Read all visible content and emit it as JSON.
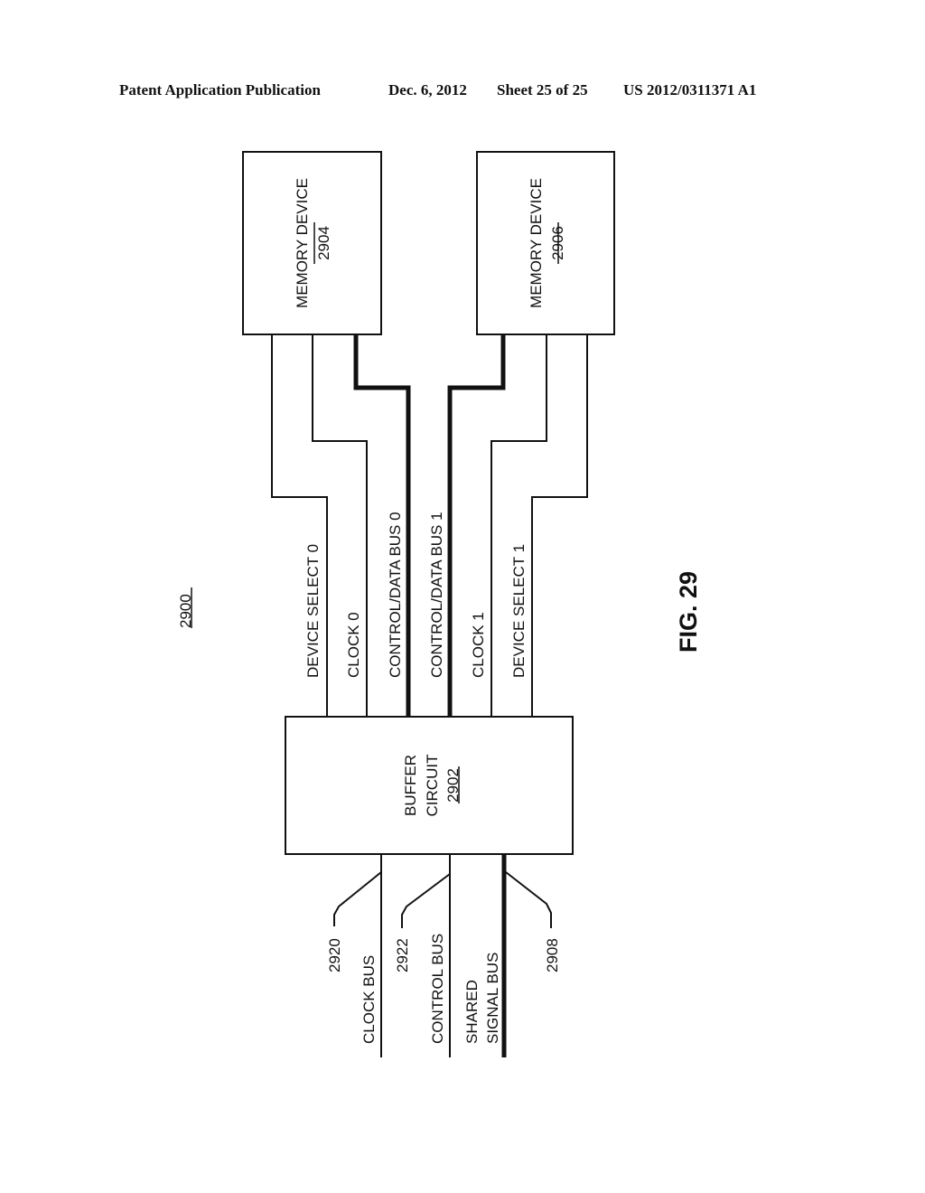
{
  "header": {
    "publication": "Patent Application Publication",
    "date": "Dec. 6, 2012",
    "sheet": "Sheet 25 of 25",
    "patent_number": "US 2012/0311371 A1"
  },
  "figure": {
    "label": "FIG. 29",
    "reference": "2900",
    "memory_devices": [
      {
        "name": "MEMORY DEVICE",
        "ref": "2904"
      },
      {
        "name": "MEMORY DEVICE",
        "ref": "2906"
      }
    ],
    "buffer": {
      "line1": "BUFFER",
      "line2": "CIRCUIT",
      "ref": "2902"
    },
    "signals": [
      {
        "label": "DEVICE SELECT 0",
        "bus": false
      },
      {
        "label": "CLOCK 0",
        "bus": false
      },
      {
        "label": "CONTROL/DATA BUS 0",
        "bus": true
      },
      {
        "label": "CONTROL/DATA BUS 1",
        "bus": true
      },
      {
        "label": "CLOCK 1",
        "bus": false
      },
      {
        "label": "DEVICE SELECT 1",
        "bus": false
      }
    ],
    "input_buses": [
      {
        "label": "CLOCK BUS",
        "ref": "2920"
      },
      {
        "label": "CONTROL BUS",
        "ref": "2922"
      },
      {
        "label_line1": "SHARED",
        "label_line2": "SIGNAL BUS",
        "ref": "2908"
      }
    ]
  }
}
